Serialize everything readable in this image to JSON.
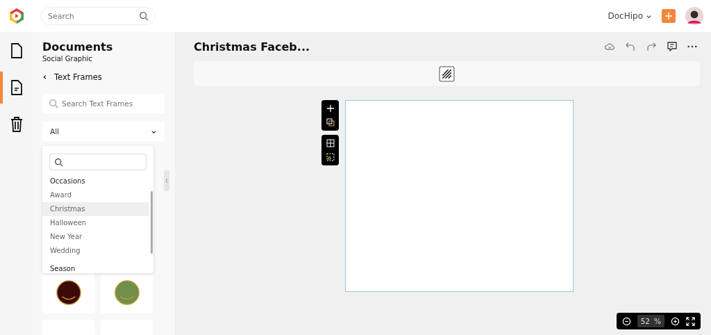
{
  "topbar": {
    "search": {
      "placeholder": "Search"
    },
    "account": "DocHipo"
  },
  "rail": [
    {
      "kind": "page",
      "selected": false
    },
    {
      "kind": "doc",
      "selected": true
    },
    {
      "kind": "trash",
      "selected": false
    }
  ],
  "panel": {
    "title": "Documents",
    "subtitle": "Social Graphic",
    "back_label": "Text Frames",
    "search": {
      "placeholder": "Search Text Frames"
    },
    "filter": "All",
    "dropdown": {
      "groups": [
        {
          "label": "Occasions",
          "items": [
            {
              "label": "Award",
              "selected": false
            },
            {
              "label": "Christmas",
              "selected": true
            },
            {
              "label": "Halloween",
              "selected": false
            },
            {
              "label": "New Year",
              "selected": false
            },
            {
              "label": "Wedding",
              "selected": false
            }
          ]
        },
        {
          "label": "Season"
        }
      ]
    },
    "thumbnails": [
      {
        "kind": "round",
        "color": "#3d0a0a"
      },
      {
        "kind": "round",
        "color": "#6f8f4a"
      },
      {
        "kind": "blank"
      },
      {
        "kind": "blank"
      }
    ]
  },
  "editor": {
    "title": "Christmas Faceb...",
    "zoom": "52",
    "zoom_unit": "%"
  }
}
